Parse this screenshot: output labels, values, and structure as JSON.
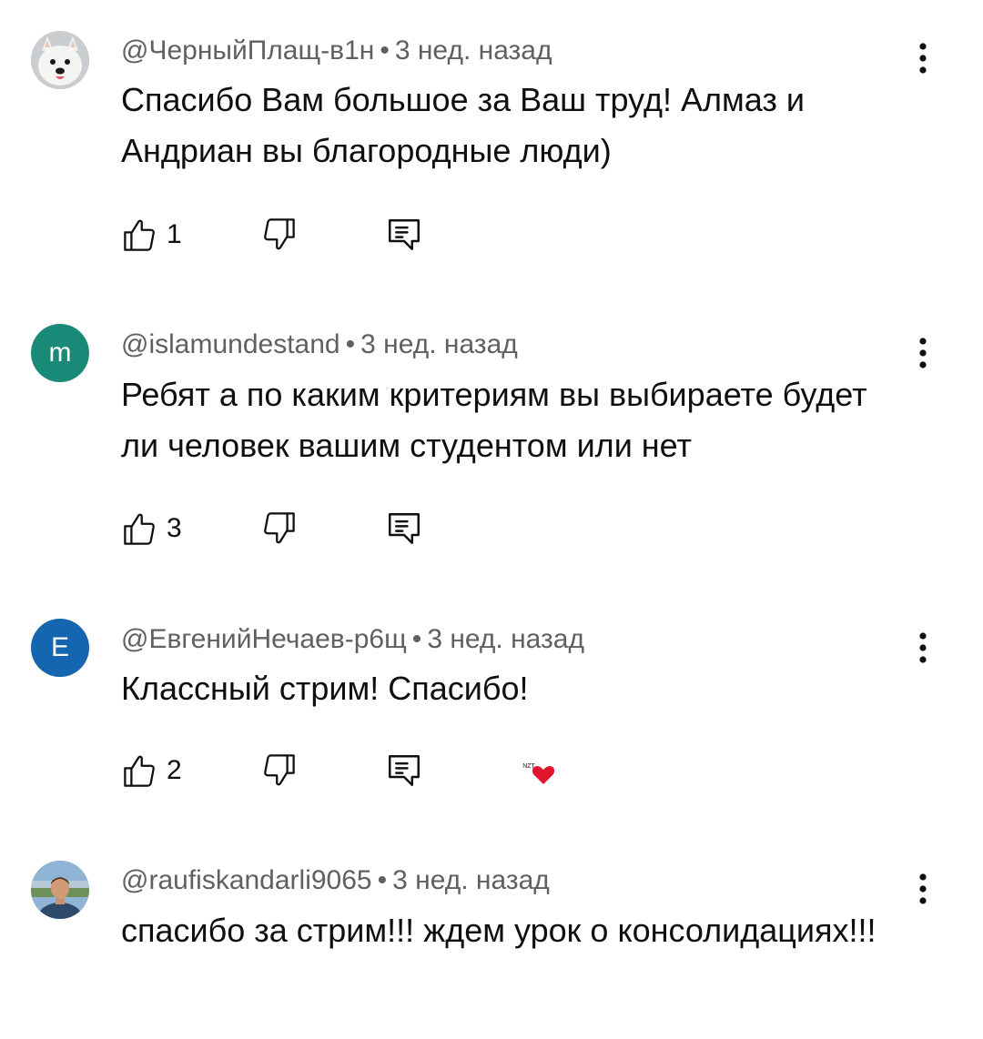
{
  "comments": [
    {
      "author": "@ЧерныйПлащ-в1н",
      "time": "3 нед. назад",
      "separator": "•",
      "text": "Спасибо Вам большое за Ваш труд! Алмаз и Андриан вы благородные люди)",
      "likes": "1",
      "avatar": {
        "type": "photo",
        "icon": "samoyed-dog-avatar"
      }
    },
    {
      "author": "@islamundestand",
      "time": "3 нед. назад",
      "separator": "•",
      "text": "Ребят а по каким критериям вы выбираете будет ли человек вашим студентом или нет",
      "likes": "3",
      "avatar": {
        "type": "letter",
        "letter": "m",
        "color": "#1a8a78"
      }
    },
    {
      "author": "@ЕвгенийНечаев-р6щ",
      "time": "3 нед. назад",
      "separator": "•",
      "text": "Классный стрим! Спасибо!",
      "likes": "2",
      "avatar": {
        "type": "letter",
        "letter": "E",
        "color": "#1565b0"
      },
      "creator_heart": {
        "badge_text": "NZT",
        "color": "#e0152e"
      }
    },
    {
      "author": "@raufiskandarli9065",
      "time": "3 нед. назад",
      "separator": "•",
      "text": "спасибо за стрим!!! ждем урок о консолидациях!!!",
      "avatar": {
        "type": "photo",
        "icon": "man-portrait-avatar"
      }
    }
  ],
  "icons": {
    "like": "thumbs-up-icon",
    "dislike": "thumbs-down-icon",
    "reply": "reply-comment-icon",
    "more": "more-vertical-icon"
  }
}
